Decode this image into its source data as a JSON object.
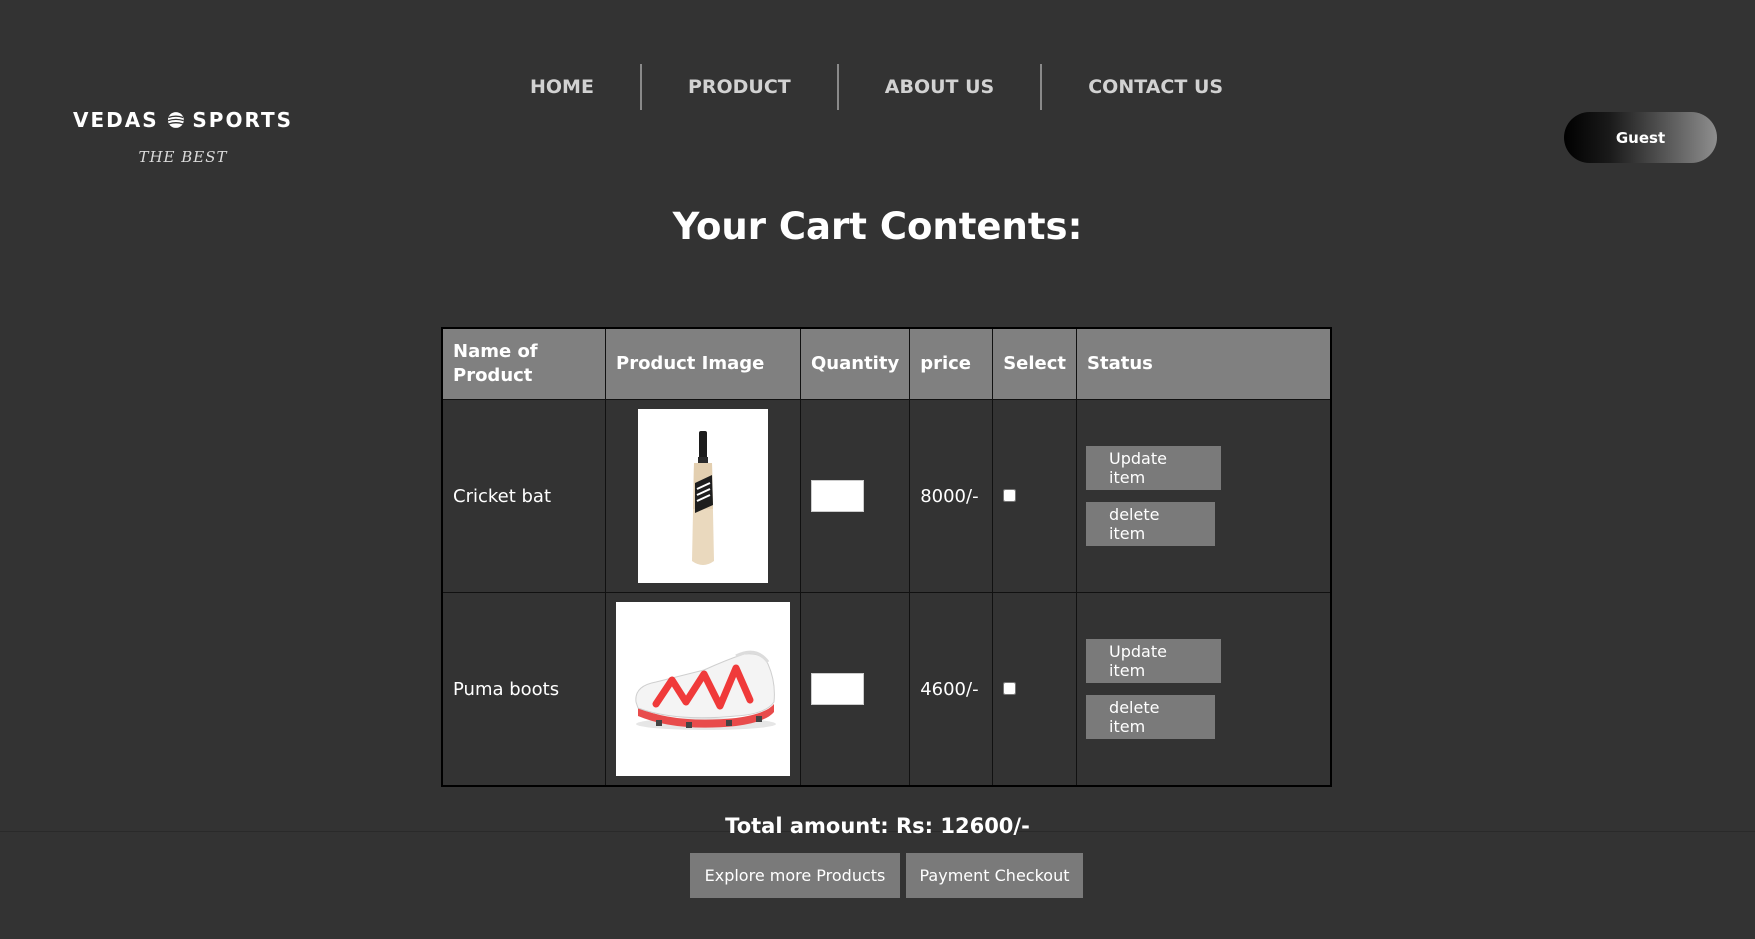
{
  "brand": {
    "name_left": "VEDAS",
    "name_right": "SPORTS",
    "tagline": "THE BEST",
    "logo_icon": "volleyball-icon"
  },
  "nav": {
    "items": [
      {
        "label": "HOME"
      },
      {
        "label": "PRODUCT"
      },
      {
        "label": "ABOUT US"
      },
      {
        "label": "CONTACT US"
      }
    ]
  },
  "user": {
    "label": "Guest"
  },
  "page": {
    "title": "Your Cart Contents:"
  },
  "cart": {
    "headers": {
      "name": "Name of Product",
      "image": "Product Image",
      "quantity": "Quantity",
      "price": "price",
      "select": "Select",
      "status": "Status"
    },
    "items": [
      {
        "name": "Cricket bat",
        "image_icon": "cricket-bat-icon",
        "quantity": "",
        "price": "8000/-",
        "selected": false,
        "update_label": "Update item",
        "delete_label": "delete item"
      },
      {
        "name": "Puma boots",
        "image_icon": "football-boot-icon",
        "quantity": "",
        "price": "4600/-",
        "selected": false,
        "update_label": "Update item",
        "delete_label": "delete item"
      }
    ],
    "total_text": "Total amount: Rs: 12600/-"
  },
  "footer": {
    "explore_label": "Explore more Products",
    "checkout_label": "Payment Checkout"
  },
  "colors": {
    "background": "#333333",
    "table_header": "#808080",
    "button": "#7a7a7a",
    "boot_accent": "#f03a3a"
  }
}
